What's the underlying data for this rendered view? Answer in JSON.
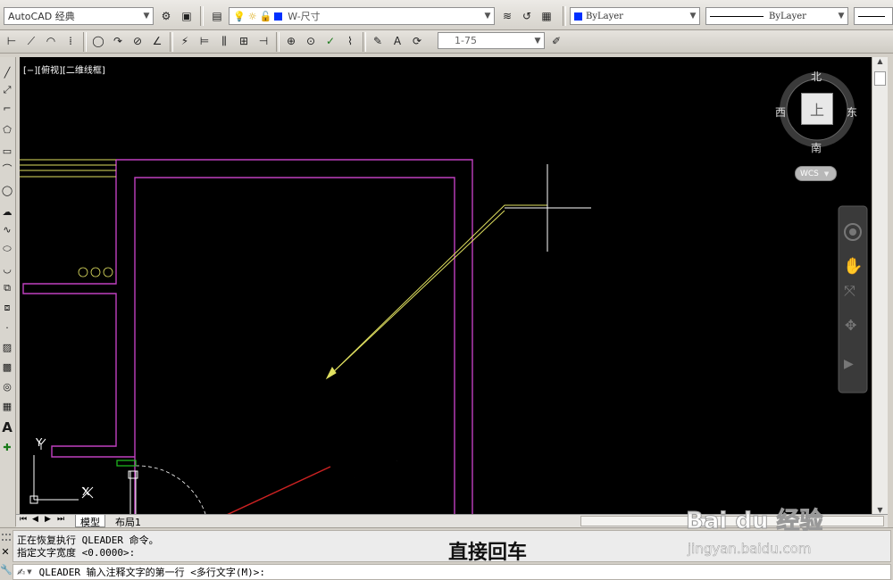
{
  "toolbar_top": {
    "workspace": "AutoCAD 经典",
    "layer": "W-尺寸",
    "color": "ByLayer",
    "linetype": "ByLayer",
    "dim_scale": "1-75"
  },
  "viewport_label": "[−][俯视][二维线框]",
  "viewcube": {
    "north": "北",
    "south": "南",
    "east": "东",
    "west": "西",
    "top_face": "上",
    "wcs": "WCS"
  },
  "ucs": {
    "y": "Y",
    "x": "X"
  },
  "layout_tabs": {
    "model": "模型",
    "layout1": "布局1"
  },
  "command_history": [
    "正在恢复执行 QLEADER 命令。",
    "指定文字宽度 <0.0000>:"
  ],
  "command_prompt": "QLEADER 输入注释文字的第一行 <多行文字(M)>:",
  "annotations": {
    "first": "直接回车",
    "second": "直接回车"
  },
  "watermark": {
    "brand": "Bai du 经验",
    "url": "jingyan.baidu.com"
  },
  "colors": {
    "canvas": "#000000",
    "wall": "#c040c0",
    "leader": "#e0e060",
    "annotation_line": "#cc2222"
  }
}
